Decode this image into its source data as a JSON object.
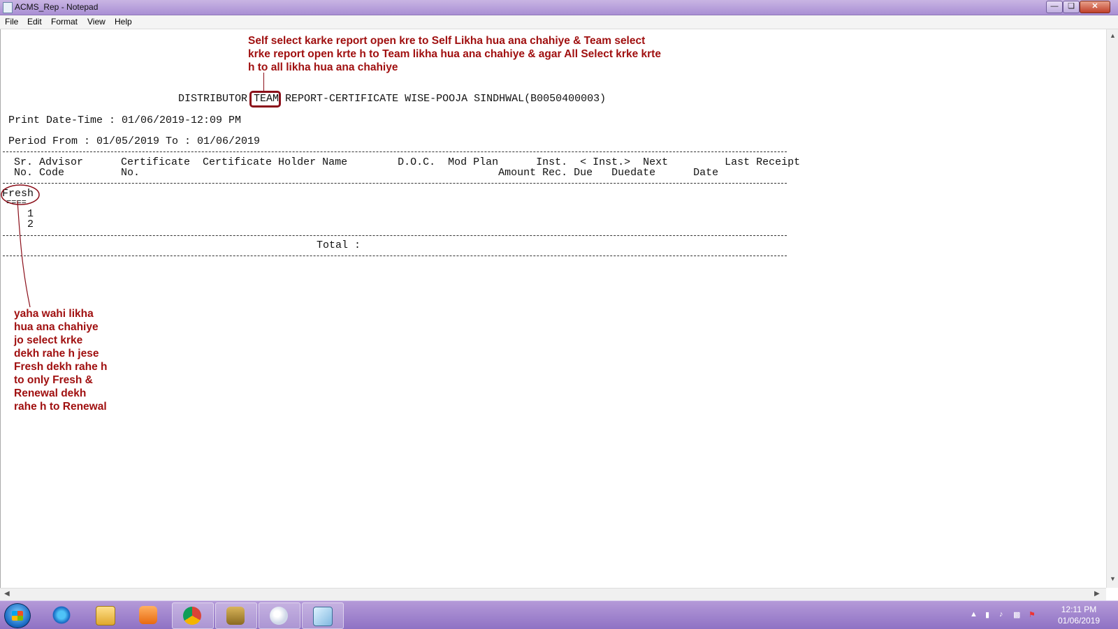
{
  "window": {
    "title": "ACMS_Rep - Notepad"
  },
  "menu": [
    "File",
    "Edit",
    "Format",
    "View",
    "Help"
  ],
  "report": {
    "heading_before": "DISTRIBUTOR ",
    "heading_highlight": "TEAM",
    "heading_after": " REPORT-CERTIFICATE WISE-POOJA SINDHWAL(B0050400003)",
    "print_datetime": "Print Date-Time : 01/06/2019-12:09 PM",
    "period": "Period From : 01/05/2019 To : 01/06/2019",
    "header_line1": "Sr. Advisor      Certificate  Certificate Holder Name        D.O.C.  Mod Plan      Inst.  < Inst.>  Next         Last Receipt",
    "header_line2": "No. Code         No.                                                         Amount Rec. Due   Duedate      Date",
    "section_label": "Fresh",
    "section_underline": "====",
    "rows": [
      "1",
      "2"
    ],
    "total_label": "Total :"
  },
  "annotations": {
    "top_note": [
      "Self select karke  report open kre to Self Likha hua ana chahiye & Team select",
      "krke report open krte h to Team likha hua ana chahiye & agar All Select krke krte",
      "h to all likha hua ana chahiye"
    ],
    "side_note": [
      "yaha wahi likha",
      "hua ana chahiye",
      "jo select krke",
      "dekh rahe h jese",
      "Fresh dekh rahe h",
      "to only Fresh &",
      "Renewal dekh",
      "rahe h to Renewal"
    ]
  },
  "taskbar": {
    "items": [
      "start-button",
      "internet-explorer-icon",
      "file-explorer-icon",
      "media-player-icon",
      "chrome-icon",
      "app-icon",
      "paint-icon",
      "notepad-icon"
    ],
    "clock_time": "12:11 PM",
    "clock_date": "01/06/2019"
  },
  "colors": {
    "annotation": "#a01010",
    "taskbar": "#9f84cc"
  }
}
